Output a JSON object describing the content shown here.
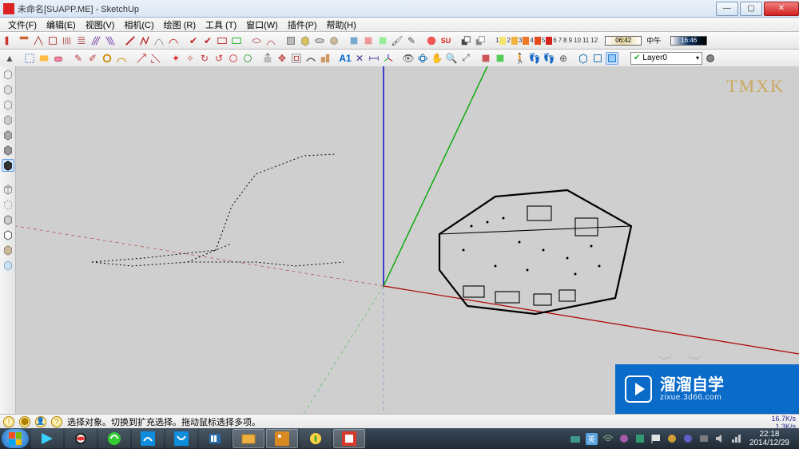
{
  "title": "未命名[SUAPP.ME] - SketchUp",
  "menu": [
    "文件(F)",
    "编辑(E)",
    "视图(V)",
    "相机(C)",
    "绘图 (R)",
    "工具 (T)",
    "窗口(W)",
    "插件(P)",
    "帮助(H)"
  ],
  "legend_numbers": [
    "1",
    "2",
    "3",
    "4",
    "5",
    "6",
    "7",
    "8",
    "9",
    "10",
    "11",
    "12"
  ],
  "legend_colors": [
    "#f7e36a",
    "#f2b33c",
    "#ec7a24",
    "#e64a19",
    "#d8231b",
    "#b11616",
    "#7d0f12",
    "#5a0b0e",
    "#3e080a",
    "#2c0607",
    "#1e0405",
    "#120203"
  ],
  "time1": "06:42",
  "time_mid": "中午",
  "time2": "16:46",
  "layer": "Layer0",
  "status_text": "选择对象。切换到扩充选择。拖动鼠标选择多项。",
  "speed1": "16.7K/s",
  "speed2": "1.3K/s",
  "clock_time": "22:18",
  "clock_date": "2014/12/29",
  "watermark": "TMXK",
  "brand_cn": "溜溜自学",
  "brand_url": "zixue.3d66.com",
  "tray_lang": "英"
}
